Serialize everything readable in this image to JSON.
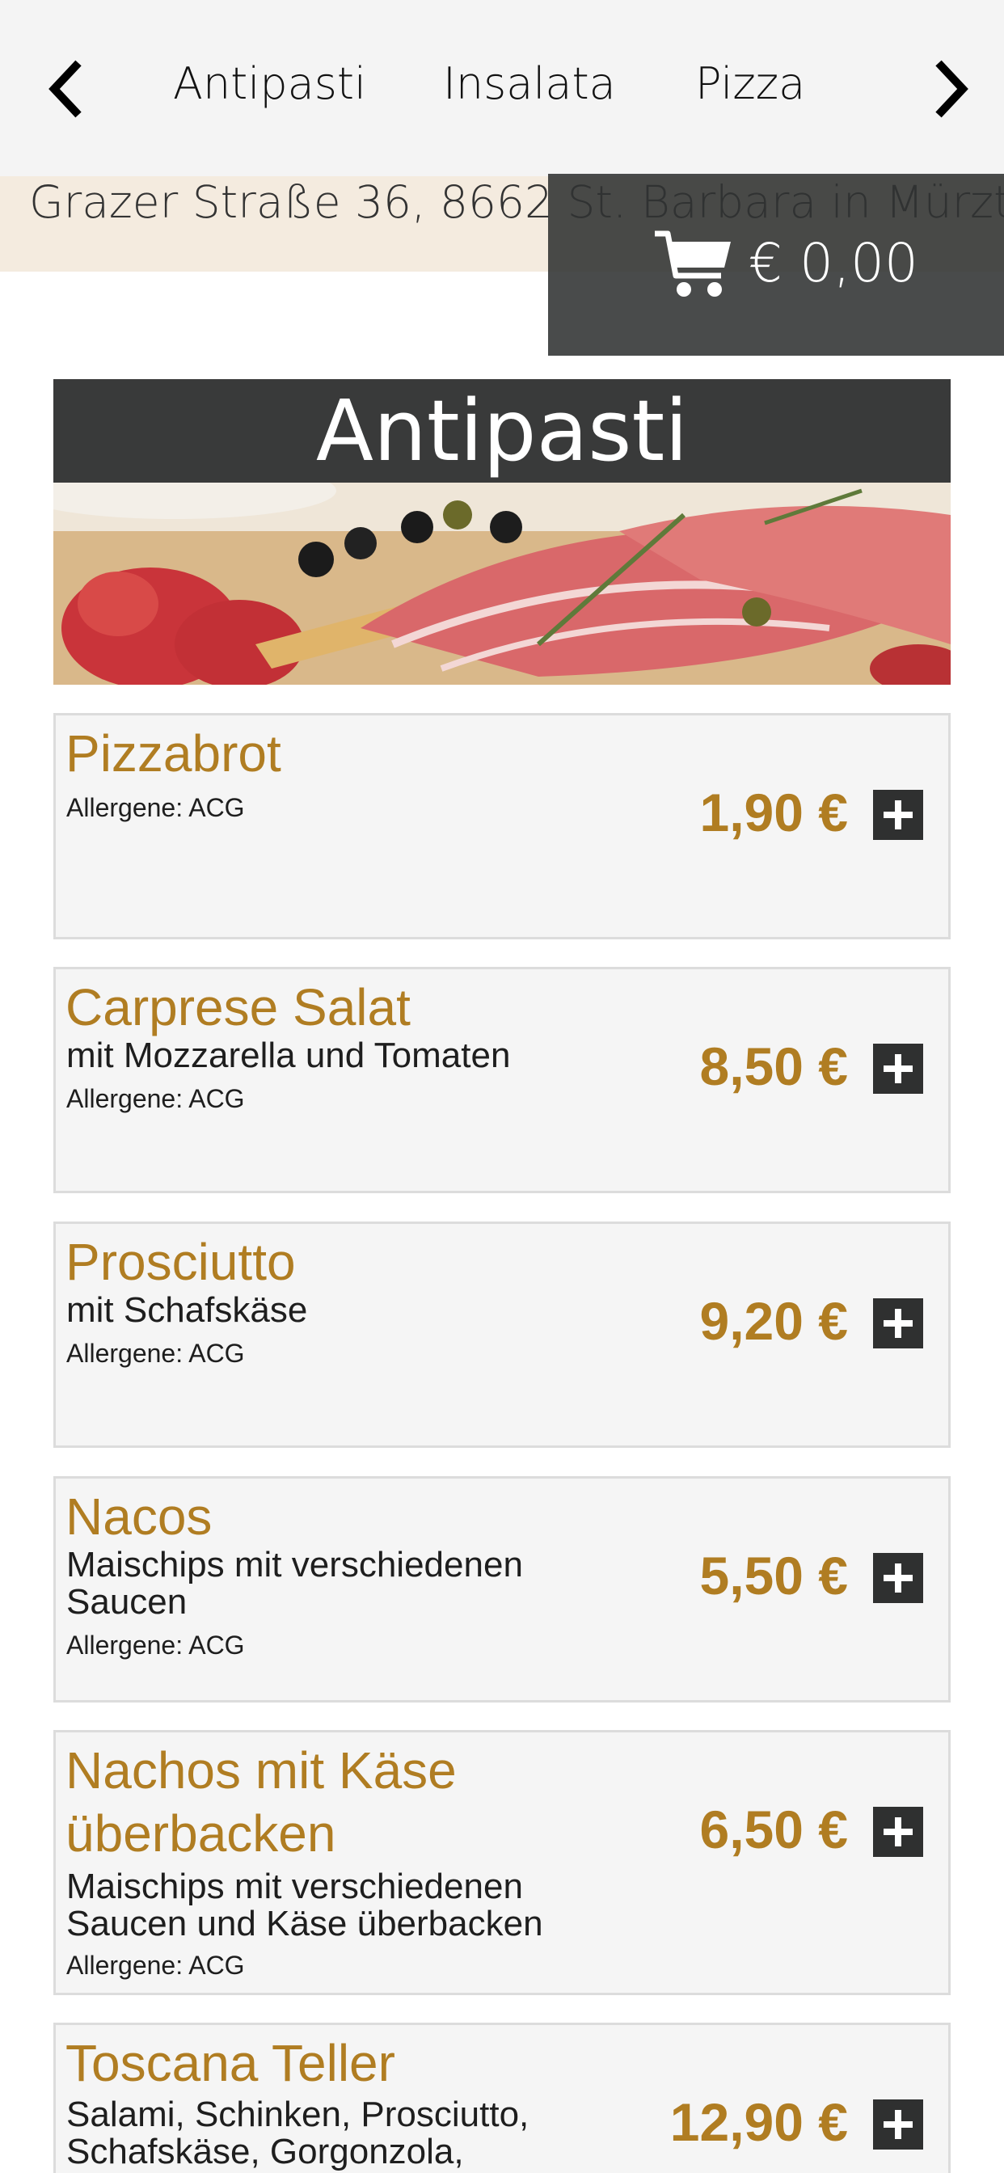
{
  "nav": {
    "prev_icon": "chevron-left-icon",
    "next_icon": "chevron-right-icon",
    "tabs": [
      "Antipasti",
      "Insalata",
      "Pizza"
    ]
  },
  "header": {
    "address": "Grazer Straße 36, 8662 St. Barbara in Mürztal"
  },
  "cart": {
    "icon": "cart-icon",
    "total": "€ 0,00"
  },
  "section": {
    "title": "Antipasti",
    "image": "antipasti-platter-photo"
  },
  "items": [
    {
      "name": "Pizzabrot",
      "desc": "",
      "allergens": "Allergene: ACG",
      "price": "1,90 €"
    },
    {
      "name": "Carprese Salat",
      "desc": "mit Mozzarella und Tomaten",
      "allergens": "Allergene: ACG",
      "price": "8,50 €"
    },
    {
      "name": "Prosciutto",
      "desc": "mit Schafskäse",
      "allergens": "Allergene: ACG",
      "price": "9,20 €"
    },
    {
      "name": "Nacos",
      "desc": "Maischips mit verschiedenen Saucen",
      "allergens": "Allergene: ACG",
      "price": "5,50 €"
    },
    {
      "name": "Nachos mit Käse überbacken",
      "desc": "Maischips mit verschiedenen Saucen und Käse überbacken",
      "allergens": "Allergene: ACG",
      "price": "6,50 €"
    },
    {
      "name": "Toscana Teller",
      "desc": "Salami, Schinken, Prosciutto, Schafskäse, Gorgonzola,",
      "allergens": "",
      "price": "12,90 €"
    }
  ],
  "colors": {
    "accent": "#b07d22",
    "dark": "#393a3a",
    "card_bg": "#f5f5f5",
    "address_band": "#f4ebdf"
  }
}
